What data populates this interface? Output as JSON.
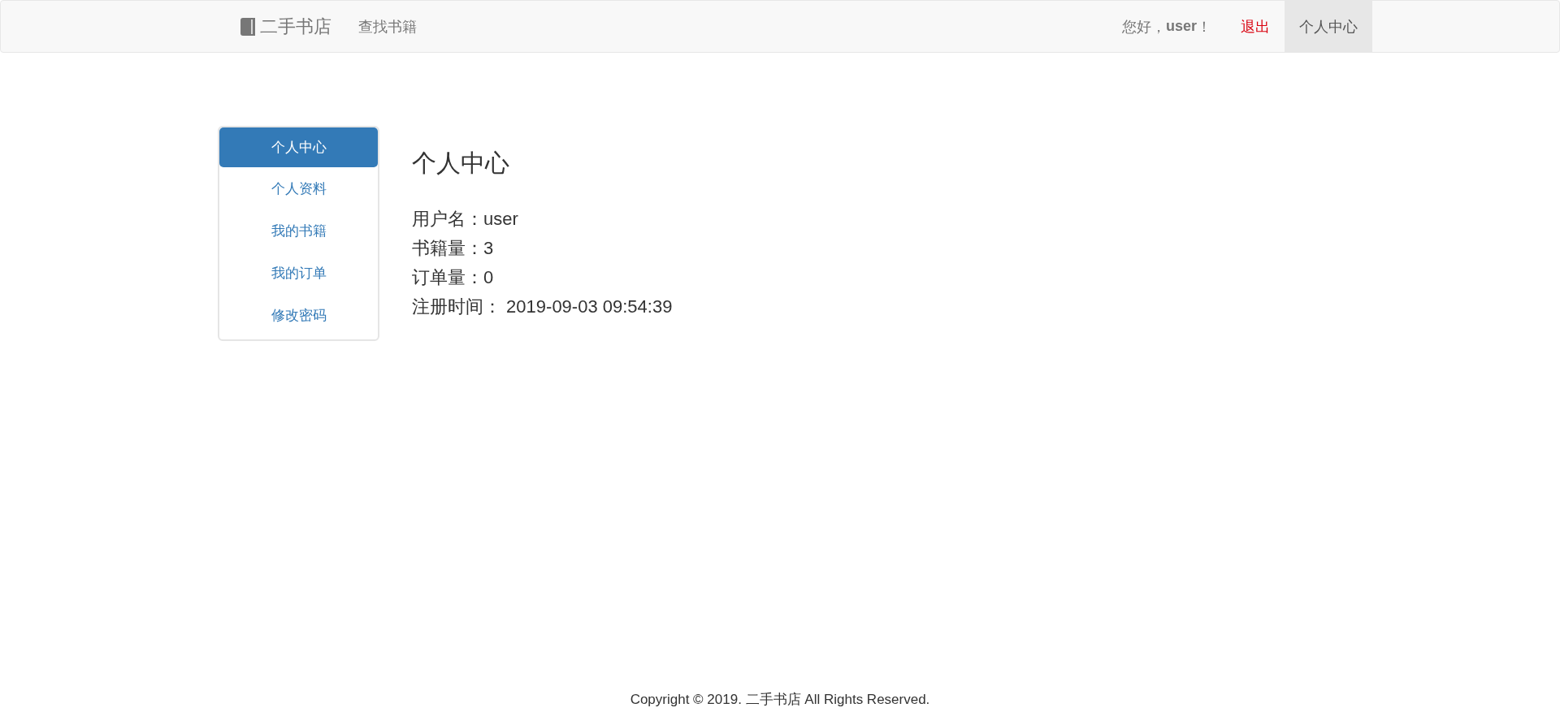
{
  "navbar": {
    "brand": "二手书店",
    "links": [
      {
        "label": "查找书籍",
        "selected": false
      }
    ],
    "greeting": "您好，**user**！",
    "logout": "退出",
    "right_links": [
      {
        "label": "个人中心",
        "selected": true
      }
    ]
  },
  "sidebar": {
    "items": [
      {
        "label": "个人中心",
        "selected": true
      },
      {
        "label": "个人资料",
        "selected": false
      },
      {
        "label": "我的书籍",
        "selected": false
      },
      {
        "label": "我的订单",
        "selected": false
      },
      {
        "label": "修改密码",
        "selected": false
      }
    ]
  },
  "content": {
    "title": "个人中心",
    "fields": [
      "用户名：user",
      "书籍量：3",
      "订单量：0",
      "注册时间： 2019-09-03 09:54:39"
    ]
  },
  "footer": "Copyright © 2019. 二手书店 All Rights Reserved."
}
